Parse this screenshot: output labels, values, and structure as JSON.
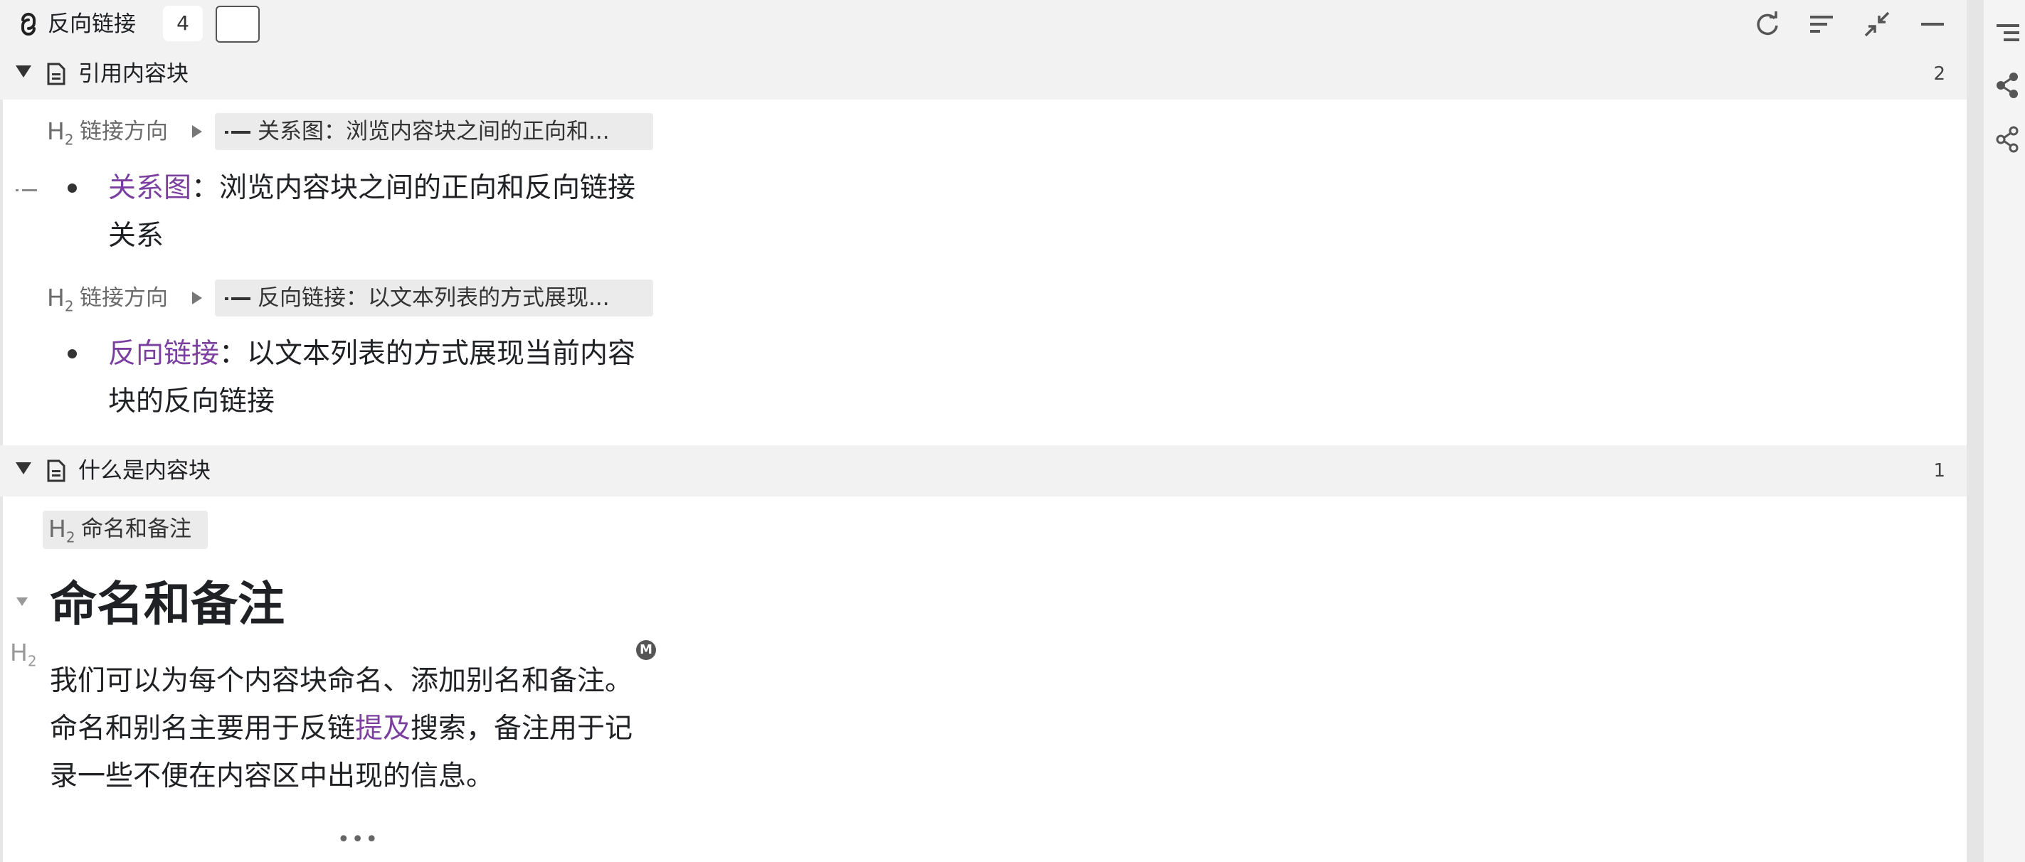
{
  "toolbar": {
    "title": "反向链接",
    "count": "4",
    "icons": [
      "backlink-icon",
      "refresh-icon",
      "sort-icon",
      "collapse-icon",
      "minimize-icon"
    ]
  },
  "sections": [
    {
      "title": "引用内容块",
      "count": "2",
      "items": [
        {
          "crumb_label": "链接方向",
          "crumb_chip": "关系图：浏览内容块之间的正向和...",
          "link": "关系图",
          "text_line1": "：浏览内容块之间的正向和反向链接",
          "text_line2": "关系"
        },
        {
          "crumb_label": "链接方向",
          "crumb_chip": "反向链接：以文本列表的方式展现...",
          "link": "反向链接",
          "text_line1": "：以文本列表的方式展现当前内容",
          "text_line2": "块的反向链接"
        }
      ]
    },
    {
      "title": "什么是内容块",
      "count": "1",
      "crumb_chip": "命名和备注",
      "heading": "命名和备注",
      "memo_badge": "M",
      "para_line1": "我们可以为每个内容块命名、添加别名和备注。",
      "para_line2_a": "命名和别名主要用于反链",
      "para_line2_link": "提及",
      "para_line2_b": "搜索，备注用于记",
      "para_line3": "录一些不便在内容区中出现的信息。",
      "more": "•••"
    }
  ],
  "h2_marker": "H",
  "h2_sub": "2",
  "colors": {
    "accent_link": "#7b3fa0",
    "header_bg": "#f2f2f2",
    "chip_bg": "#ebebeb"
  }
}
